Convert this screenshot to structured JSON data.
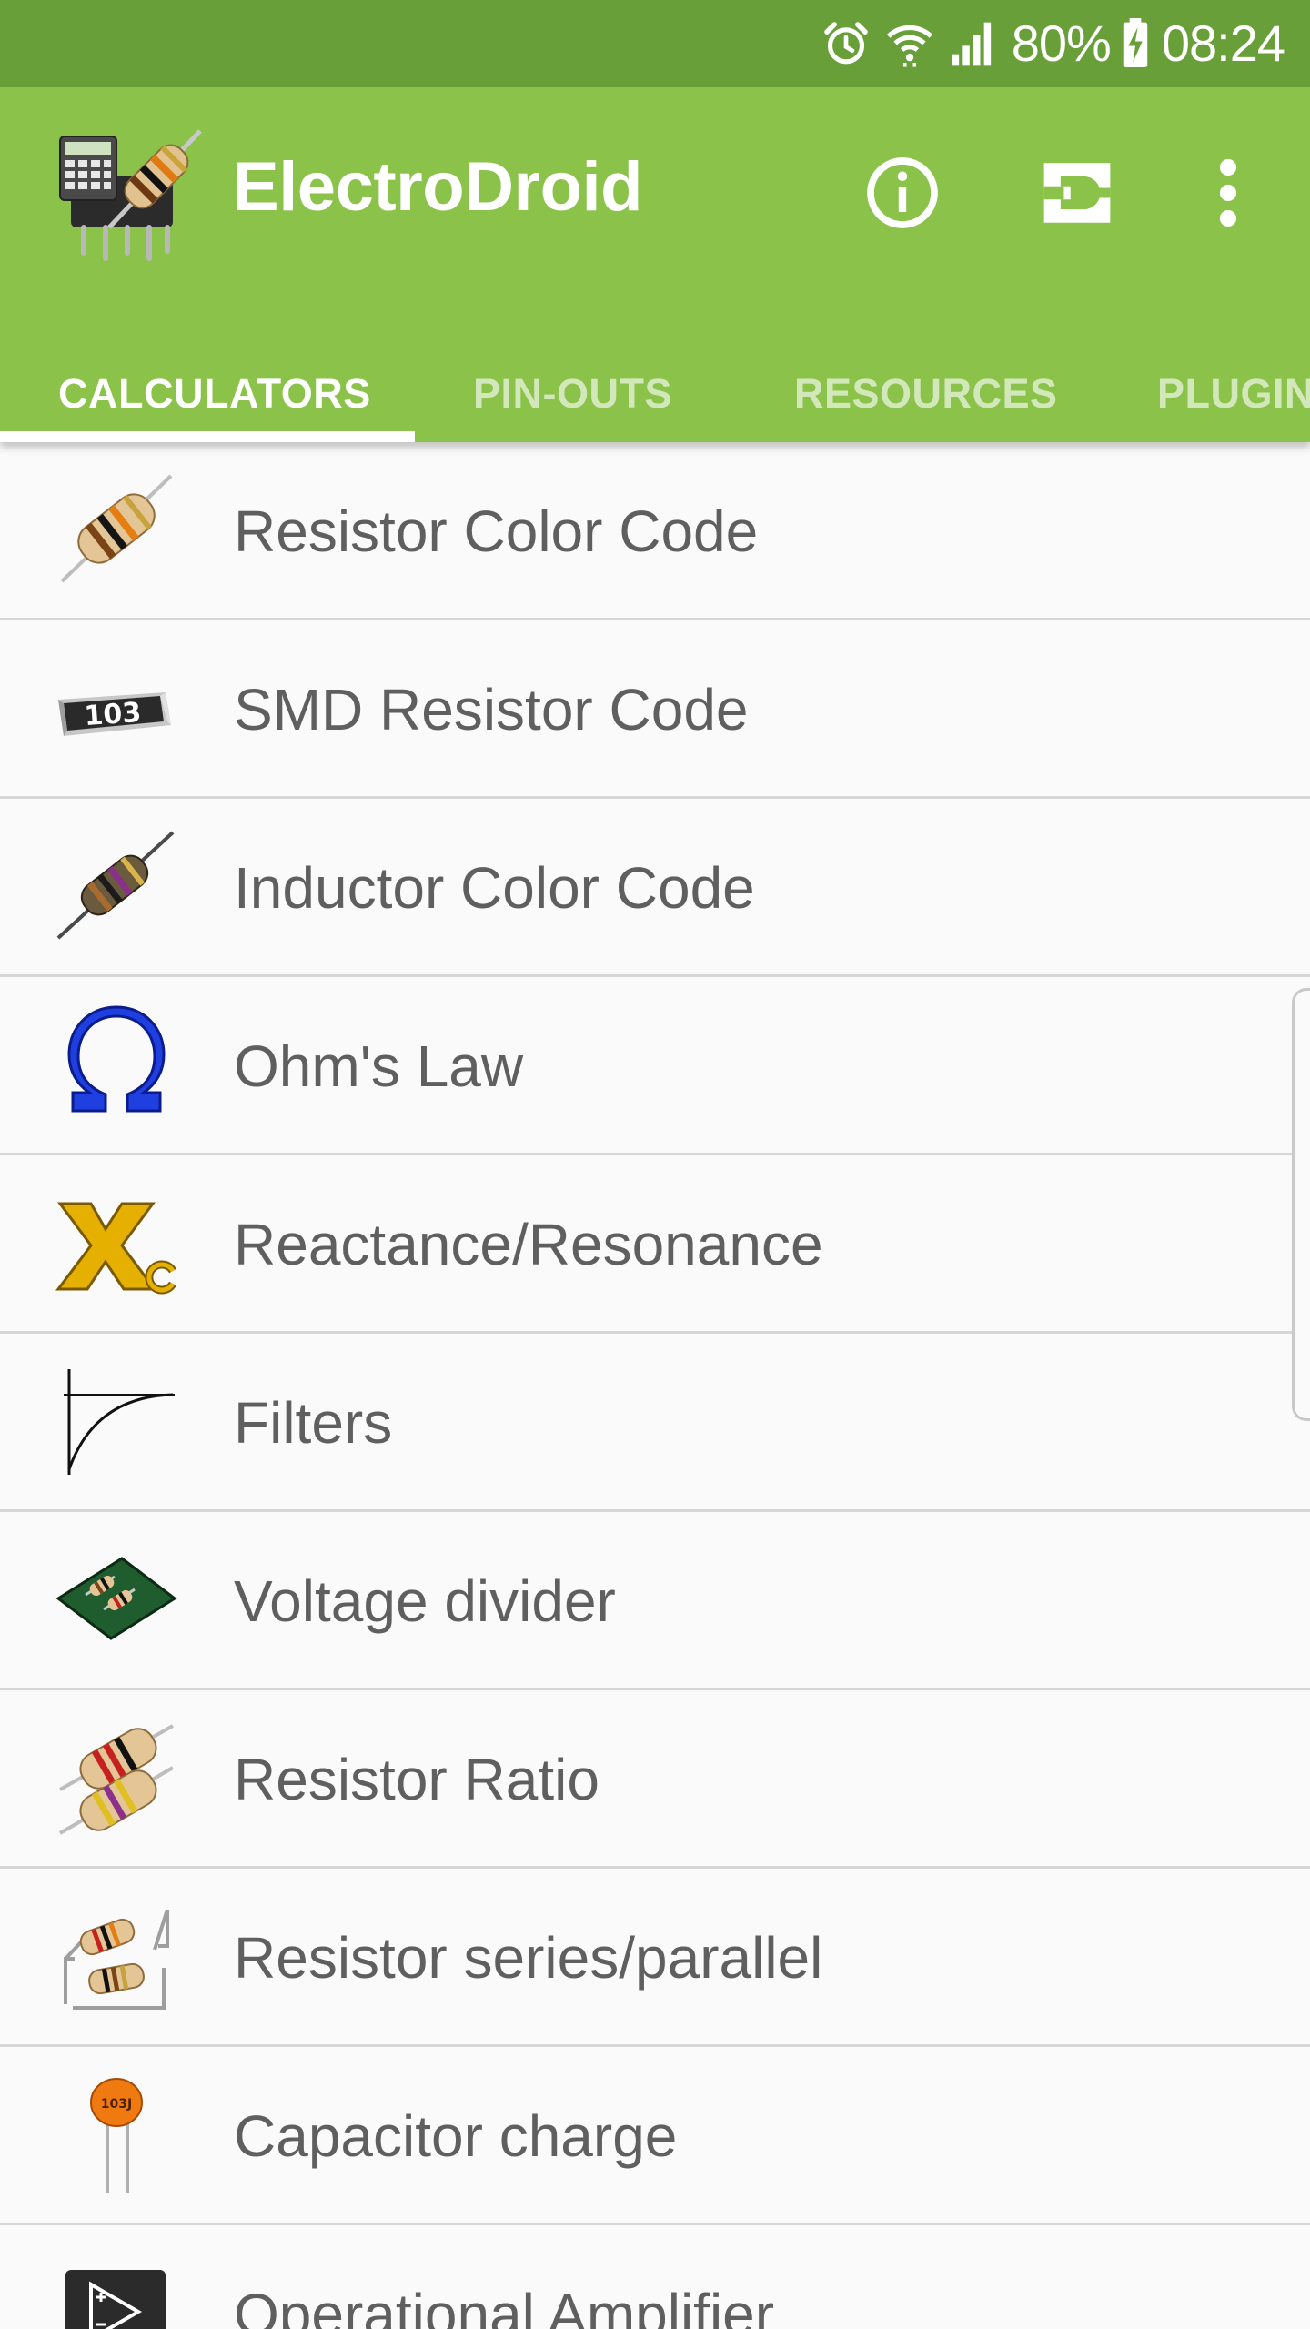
{
  "status_bar": {
    "icons": [
      "alarm-icon",
      "wifi-icon",
      "signal-icon",
      "battery-charging-icon"
    ],
    "battery_percent": "80%",
    "time": "08:24"
  },
  "app_bar": {
    "title": "ElectroDroid",
    "color": "#8bc34a",
    "status_color": "#689f38",
    "actions": [
      "info-icon",
      "plugin-icon",
      "more-vert-icon"
    ]
  },
  "tabs": {
    "items": [
      {
        "label": "CALCULATORS",
        "active": true
      },
      {
        "label": "PIN-OUTS",
        "active": false
      },
      {
        "label": "RESOURCES",
        "active": false
      },
      {
        "label": "PLUGINS",
        "active": false
      }
    ]
  },
  "list": {
    "items": [
      {
        "label": "Resistor Color Code",
        "icon": "resistor-icon"
      },
      {
        "label": "SMD Resistor Code",
        "icon": "smd-resistor-icon"
      },
      {
        "label": "Inductor Color Code",
        "icon": "inductor-icon"
      },
      {
        "label": "Ohm's Law",
        "icon": "omega-icon"
      },
      {
        "label": "Reactance/Resonance",
        "icon": "reactance-icon"
      },
      {
        "label": "Filters",
        "icon": "filter-curve-icon"
      },
      {
        "label": "Voltage divider",
        "icon": "voltage-divider-icon"
      },
      {
        "label": "Resistor Ratio",
        "icon": "resistor-ratio-icon"
      },
      {
        "label": "Resistor series/parallel",
        "icon": "resistor-series-parallel-icon"
      },
      {
        "label": "Capacitor charge",
        "icon": "capacitor-icon"
      },
      {
        "label": "Operational Amplifier",
        "icon": "opamp-icon"
      }
    ],
    "smd_code_text": "103",
    "capacitor_code_text": "103J"
  }
}
